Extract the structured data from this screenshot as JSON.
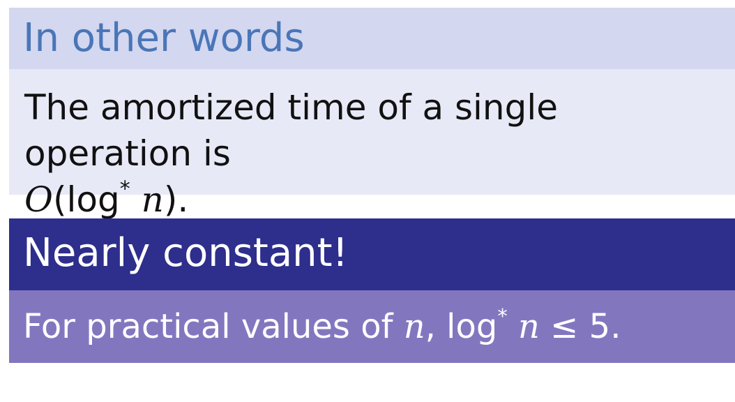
{
  "block1": {
    "title": "In other words",
    "line1": "The amortized time of a single operation is",
    "big_o": "O",
    "open_paren": "(",
    "log": "log",
    "star": "*",
    "n": "n",
    "close": ")."
  },
  "block2": {
    "title": "Nearly constant!",
    "prefix": "For practical values of ",
    "n1": "n",
    "comma": ", ",
    "log": "log",
    "star": "*",
    "n2": "n",
    "rest": " ≤ 5."
  },
  "colors": {
    "block1_header": "#d3d7ef",
    "block1_title_text": "#4a76b8",
    "block1_body": "#e7e9f6",
    "block2_header": "#2e2e8c",
    "block2_body": "#8277bf"
  }
}
